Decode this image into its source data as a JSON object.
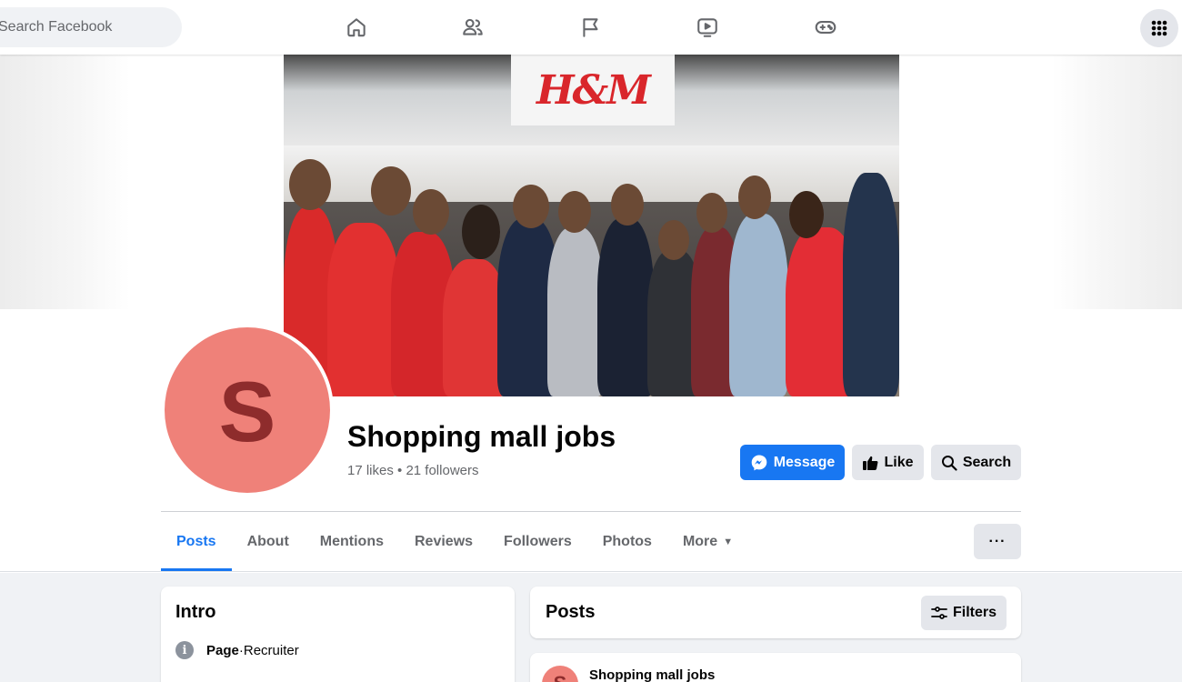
{
  "topbar": {
    "search_placeholder": "Search Facebook",
    "nav": [
      {
        "icon": "home-icon"
      },
      {
        "icon": "friends-icon"
      },
      {
        "icon": "flag-icon"
      },
      {
        "icon": "watch-icon"
      },
      {
        "icon": "gaming-icon"
      }
    ],
    "menu_icon": "grid-menu-icon"
  },
  "cover": {
    "sign_text": "H&M"
  },
  "profile": {
    "avatar_letter": "S",
    "name": "Shopping mall jobs",
    "stats": "17 likes • 21 followers"
  },
  "actions": {
    "message": "Message",
    "like": "Like",
    "search": "Search"
  },
  "tabs": [
    {
      "label": "Posts",
      "active": true
    },
    {
      "label": "About"
    },
    {
      "label": "Mentions"
    },
    {
      "label": "Reviews"
    },
    {
      "label": "Followers"
    },
    {
      "label": "Photos"
    },
    {
      "label": "More"
    }
  ],
  "more_button": "···",
  "intro": {
    "title": "Intro",
    "category_label": "Page",
    "category_separator": " · ",
    "category_value": "Recruiter"
  },
  "posts_section": {
    "title": "Posts",
    "filters": "Filters"
  },
  "post": {
    "avatar_letter": "S",
    "author": "Shopping mall jobs",
    "menu": "···"
  },
  "colors": {
    "accent": "#1877f2",
    "avatar_bg": "#ef8179",
    "avatar_letter": "#8e2c2c",
    "button_gray": "#e4e6eb",
    "page_bg": "#f0f2f5"
  }
}
